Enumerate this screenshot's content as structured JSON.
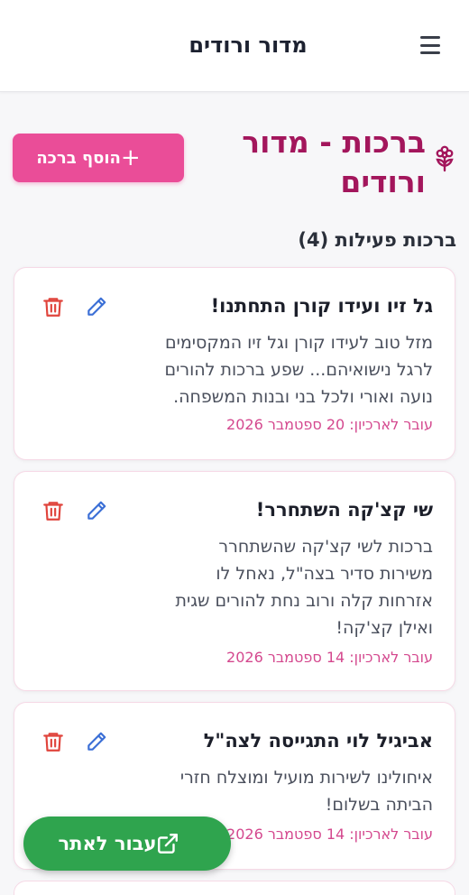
{
  "app": {
    "title": "מדור ורודים"
  },
  "page": {
    "title_line1": "ברכות - מדור",
    "title_line2": "ורודים",
    "add_button_label": "הוסף ברכה",
    "add_button_icon": "plus-icon",
    "section_title": "ברכות פעילות (4)"
  },
  "cards": [
    {
      "title": "גל זיו ועידו קורן התחתנו!",
      "body_lines": [
        "מזל טוב לעידו קורן וגל זיו המקסימים",
        "לרגל נישואיהם... שפע ברכות להורים",
        "נועה ואורי ולכל בני ובנות המשפחה."
      ],
      "date": "עובר לארכיון: 20 ספטמבר 2026"
    },
    {
      "title": "שי קצ'קה השתחרר!",
      "body_lines": [
        "ברכות לשי קצ'קה שהשתחרר",
        "משירות סדיר בצה\"ל, נאחל לו",
        "אזרחות קלה ורוב נחת להורים שגית",
        "ואילן קצ'קה!"
      ],
      "date": "עובר לארכיון: 14 ספטמבר 2026"
    },
    {
      "title": "אביגיל לוי התגייסה לצה\"ל",
      "body_lines": [
        "איחולינו לשירות מועיל ומוצלח חזרי",
        "הביתה בשלום!"
      ],
      "date": "עובר לארכיון: 14 ספטמבר 2026"
    }
  ],
  "fab": {
    "label": "עבור לאתר",
    "icon": "external-link-icon"
  },
  "colors": {
    "accent_pink": "#ea4d98",
    "title_magenta": "#a3165c",
    "date_pink": "#d4488e",
    "fab_green": "#2fa44e",
    "delete_red": "#e0443c",
    "edit_blue": "#3b6fd6"
  }
}
